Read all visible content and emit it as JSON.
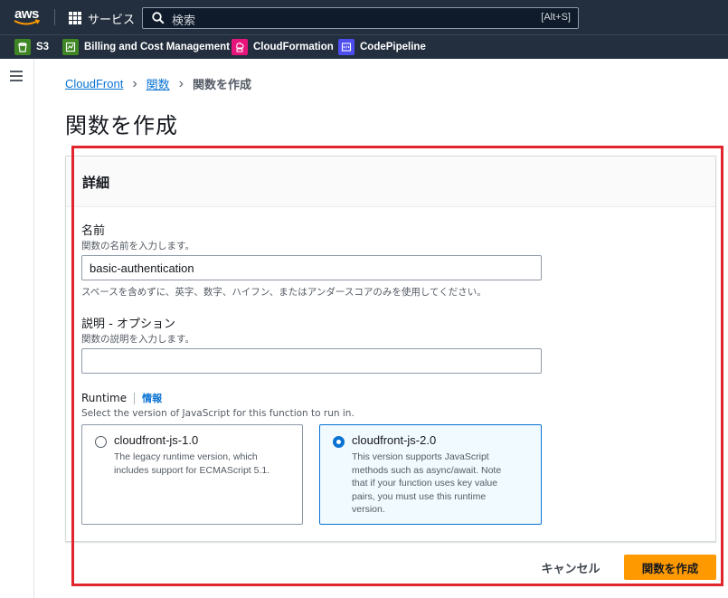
{
  "topnav": {
    "logo_text": "aws",
    "services_label": "サービス",
    "search_placeholder": "検索",
    "search_shortcut": "[Alt+S]"
  },
  "favorites": [
    {
      "label": "S3",
      "icon": "s3-icon",
      "color": "#3f8624"
    },
    {
      "label": "Billing and Cost Management",
      "icon": "billing-icon",
      "color": "#3f8624"
    },
    {
      "label": "CloudFormation",
      "icon": "cloudformation-icon",
      "color": "#e7157b"
    },
    {
      "label": "CodePipeline",
      "icon": "codepipeline-icon",
      "color": "#4d4df0"
    }
  ],
  "breadcrumb": {
    "items": [
      "CloudFront",
      "関数"
    ],
    "current": "関数を作成"
  },
  "page_title": "関数を作成",
  "panel": {
    "title": "詳細",
    "name": {
      "label": "名前",
      "description": "関数の名前を入力します。",
      "value": "basic-authentication",
      "constraint": "スペースを含めずに、英字、数字、ハイフン、またはアンダースコアのみを使用してください。"
    },
    "description": {
      "label": "説明 - オプション",
      "description": "関数の説明を入力します。",
      "value": ""
    },
    "runtime": {
      "label": "Runtime",
      "info": "情報",
      "description": "Select the version of JavaScript for this function to run in.",
      "options": [
        {
          "title": "cloudfront-js-1.0",
          "description": "The legacy runtime version, which includes support for ECMAScript 5.1.",
          "selected": false
        },
        {
          "title": "cloudfront-js-2.0",
          "description": "This version supports JavaScript methods such as async/await. Note that if your function uses key value pairs, you must use this runtime version.",
          "selected": true
        }
      ]
    }
  },
  "actions": {
    "cancel_label": "キャンセル",
    "create_label": "関数を作成"
  },
  "colors": {
    "nav_bg": "#232f3e",
    "link": "#0972d3",
    "primary_button": "#ff9900",
    "highlight_border": "#e0252d"
  }
}
